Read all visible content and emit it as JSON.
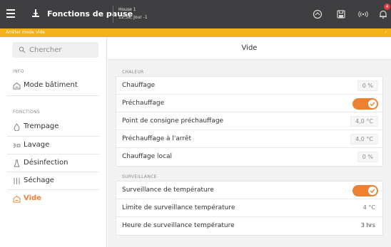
{
  "header": {
    "app_title": "Fonctions de pause",
    "house_title": "House 1",
    "house_subtitle": "12:38, Jour -1",
    "notification_count": "4",
    "icons": [
      "menu-icon",
      "pause-icon",
      "dashboard-icon",
      "save-icon",
      "broadcast-icon",
      "bell-icon"
    ]
  },
  "banner": {
    "text": "Arrêter mode Vide",
    "close_glyph": "›"
  },
  "sidebar": {
    "search_placeholder": "Chercher",
    "info_label": "INFO",
    "info_items": [
      {
        "label": "Mode bâtiment",
        "icon": "building-icon"
      }
    ],
    "functions_label": "FONCTIONS",
    "items": [
      {
        "label": "Trempage",
        "icon": "drop-icon",
        "active": false
      },
      {
        "label": "Lavage",
        "icon": "spray-icon",
        "active": false
      },
      {
        "label": "Désinfection",
        "icon": "flask-icon",
        "active": false
      },
      {
        "label": "Séchage",
        "icon": "heat-lines-icon",
        "active": false
      },
      {
        "label": "Vide",
        "icon": "building-icon",
        "active": true
      }
    ]
  },
  "main": {
    "title": "Vide",
    "groups": [
      {
        "label": "CHALEUR",
        "rows": [
          {
            "label": "Chauffage",
            "value": "0 %",
            "kind": "boxed"
          },
          {
            "label": "Préchauffage",
            "value": "",
            "kind": "toggle",
            "on": true
          },
          {
            "label": "Point de consigne préchauffage",
            "value": "4,0 °C",
            "kind": "boxed"
          },
          {
            "label": "Préchauffage à l'arrêt",
            "value": "4,0 °C",
            "kind": "boxed"
          },
          {
            "label": "Chauffage local",
            "value": "0 %",
            "kind": "boxed"
          }
        ]
      },
      {
        "label": "SURVEILLANCE",
        "rows": [
          {
            "label": "Surveillance de température",
            "value": "",
            "kind": "toggle",
            "on": true
          },
          {
            "label": "Limite de surveillance température",
            "value": "4 °C",
            "kind": "plain"
          },
          {
            "label": "Heure de surveillance température",
            "value": "3 hrs",
            "kind": "plain-dark"
          }
        ]
      }
    ]
  },
  "colors": {
    "accent": "#ee8130",
    "topbar": "#3f3f41",
    "banner": "#f3b21a",
    "badge": "#e23b3b"
  }
}
